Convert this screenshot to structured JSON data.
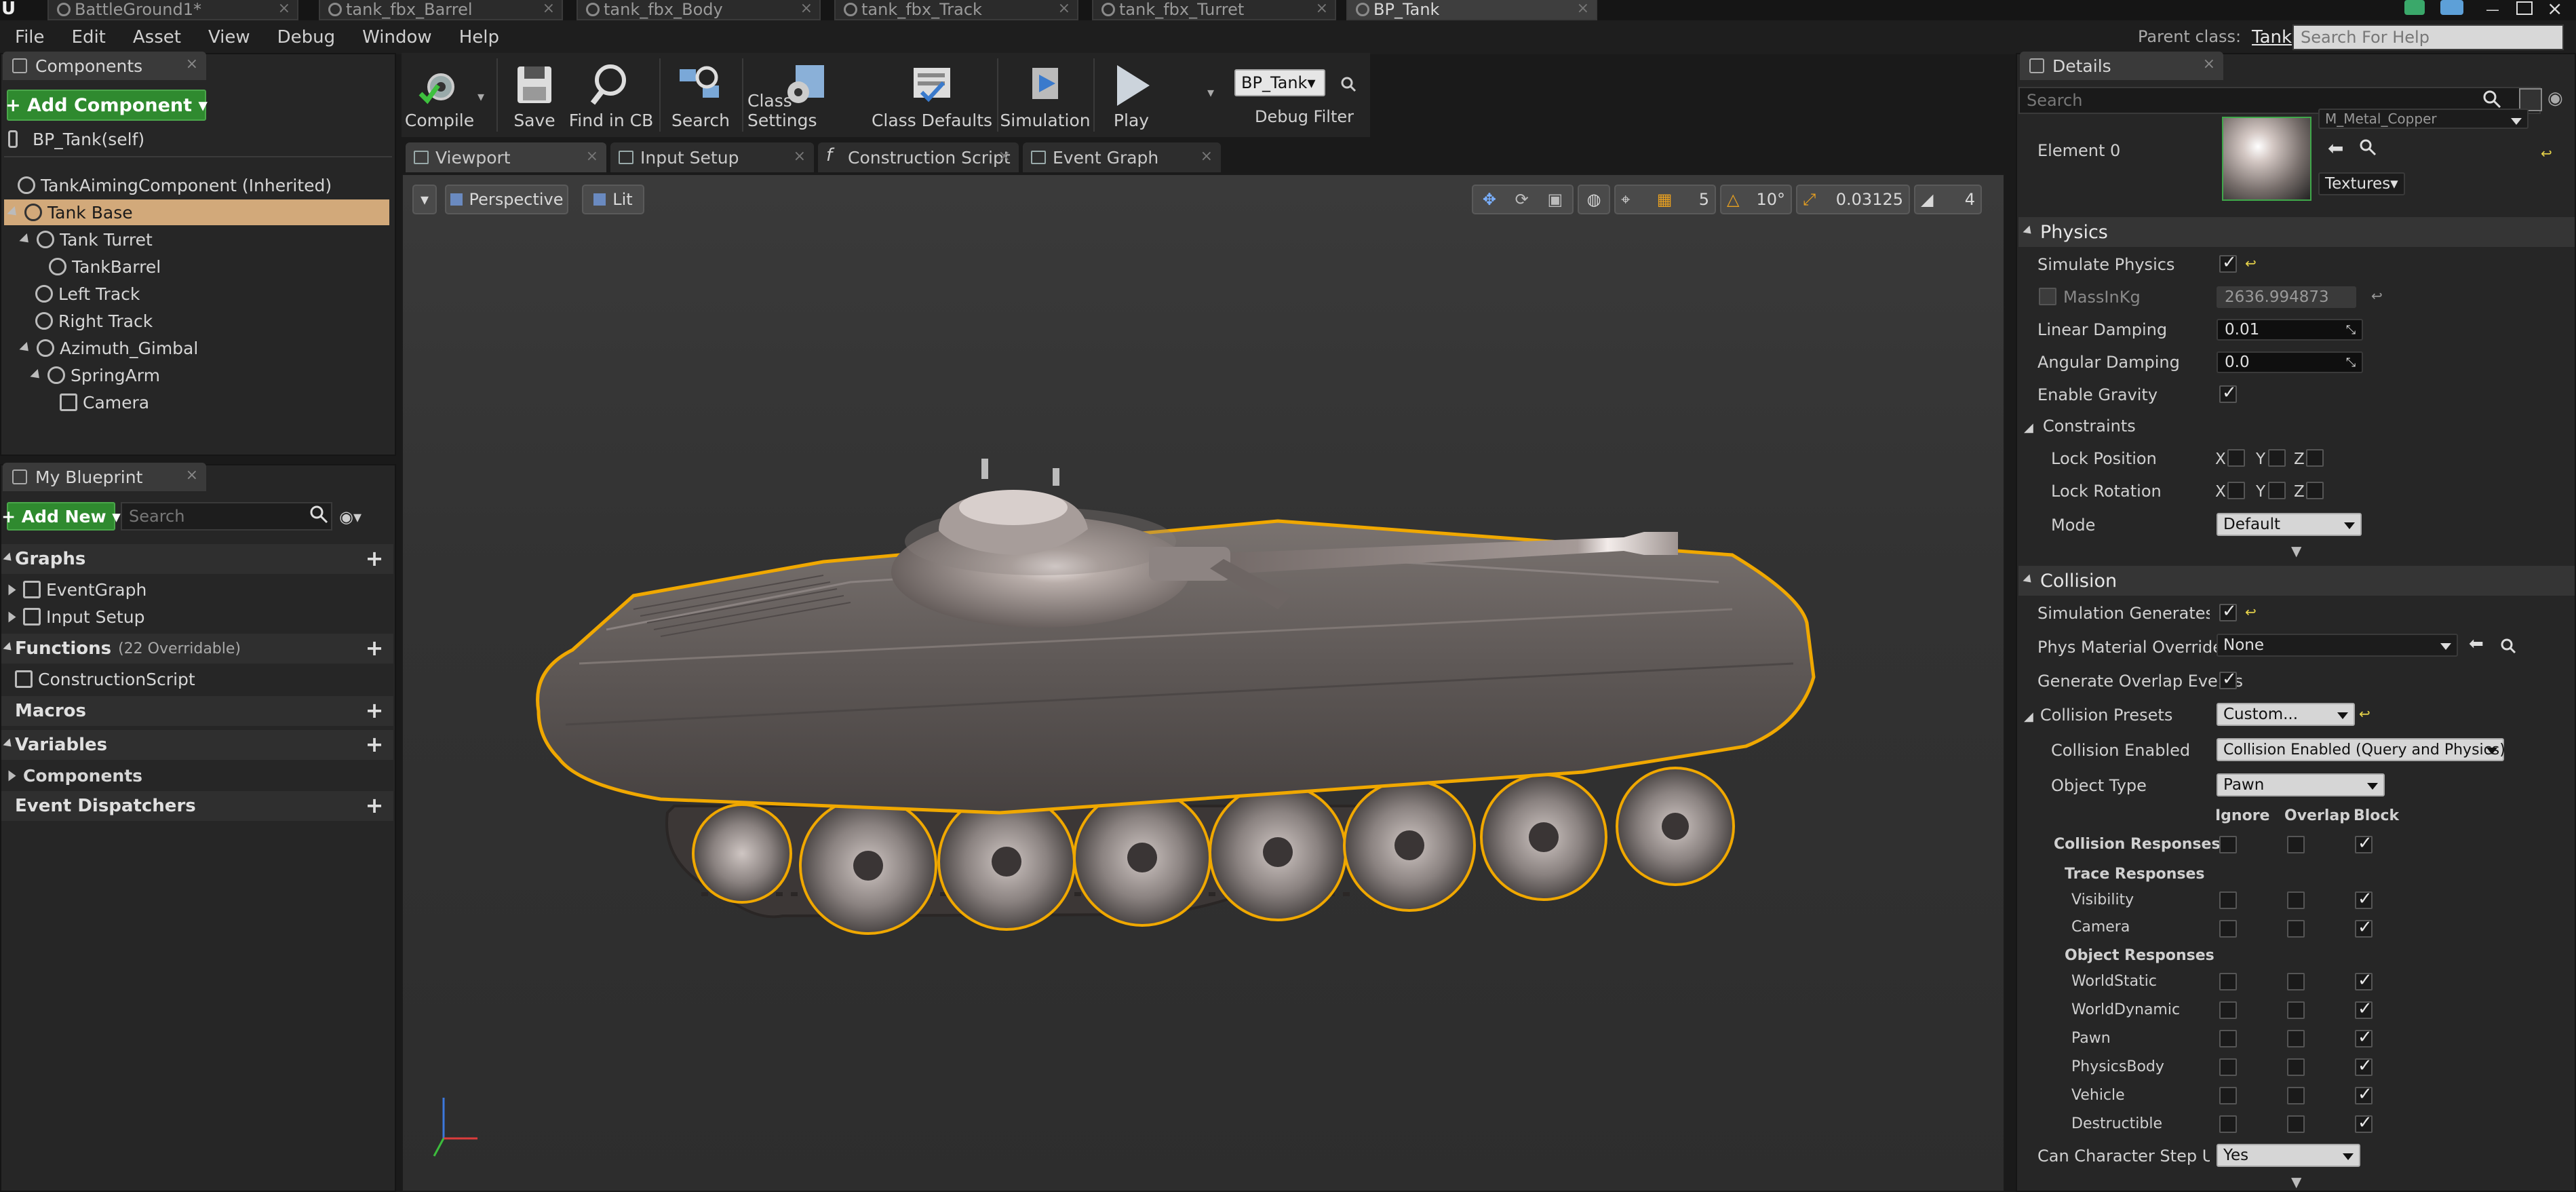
{
  "window": {
    "doc_tabs": [
      "BattleGround1*",
      "tank_fbx_Barrel",
      "tank_fbx_Body",
      "tank_fbx_Track",
      "tank_fbx_Turret",
      "BP_Tank"
    ]
  },
  "menu": [
    "File",
    "Edit",
    "Asset",
    "View",
    "Debug",
    "Window",
    "Help"
  ],
  "header_right": {
    "parent_class_label": "Parent class:",
    "parent_class_value": "Tank",
    "help_search_placeholder": "Search For Help"
  },
  "components": {
    "tab_label": "Components",
    "add_button": "+ Add Component ▾",
    "self_item": "BP_Tank(self)",
    "items": [
      {
        "label": "TankAimingComponent (Inherited)"
      },
      {
        "label": "Tank Base"
      },
      {
        "label": "Tank Turret"
      },
      {
        "label": "TankBarrel"
      },
      {
        "label": "Left Track"
      },
      {
        "label": "Right Track"
      },
      {
        "label": "Azimuth_Gimbal"
      },
      {
        "label": "SpringArm"
      },
      {
        "label": "Camera"
      }
    ]
  },
  "my_blueprint": {
    "tab_label": "My Blueprint",
    "add_new": "+ Add New ▾",
    "search_placeholder": "Search",
    "graphs_label": "Graphs",
    "graph_items": [
      "EventGraph",
      "Input Setup"
    ],
    "functions_label": "Functions",
    "functions_count": "(22 Overridable)",
    "function_items": [
      "ConstructionScript"
    ],
    "macros_label": "Macros",
    "variables_label": "Variables",
    "components_label": "Components",
    "dispatchers_label": "Event Dispatchers"
  },
  "toolbar": {
    "compile": "Compile",
    "save": "Save",
    "find_in_cb": "Find in CB",
    "search": "Search",
    "class_settings": "Class Settings",
    "class_defaults": "Class Defaults",
    "simulation": "Simulation",
    "play": "Play",
    "debug_object": "BP_Tank▾",
    "debug_filter": "Debug Filter"
  },
  "editor_tabs": [
    "Viewport",
    "Input Setup",
    "Construction Script",
    "Event Graph"
  ],
  "viewport": {
    "perspective": "Perspective",
    "lit": "Lit",
    "grid_snap": "5",
    "rot_snap": "10°",
    "scale_snap": "0.03125",
    "cam_speed": "4"
  },
  "details": {
    "tab_label": "Details",
    "search_placeholder": "Search",
    "material_name": "M_Metal_Copper",
    "element_label": "Element 0",
    "textures_btn": "Textures▾",
    "physics": {
      "header": "Physics",
      "simulate_physics": "Simulate Physics",
      "mass_label": "MassInKg",
      "mass_value": "2636.994873",
      "linear_damping": "Linear Damping",
      "linear_damping_value": "0.01",
      "angular_damping": "Angular Damping",
      "angular_damping_value": "0.0",
      "enable_gravity": "Enable Gravity",
      "constraints": "Constraints",
      "lock_position": "Lock Position",
      "lock_rotation": "Lock Rotation",
      "axis_x": "X",
      "axis_y": "Y",
      "axis_z": "Z",
      "mode": "Mode",
      "mode_value": "Default"
    },
    "collision": {
      "header": "Collision",
      "sim_generates_hit": "Simulation Generates Hit",
      "phys_material_override": "Phys Material Override",
      "phys_material_value": "None",
      "generate_overlap": "Generate Overlap Events",
      "presets": "Collision Presets",
      "presets_value": "Custom...",
      "collision_enabled": "Collision Enabled",
      "collision_enabled_value": "Collision Enabled (Query and Physics)",
      "object_type": "Object Type",
      "object_type_value": "Pawn",
      "col_ignore": "Ignore",
      "col_overlap": "Overlap",
      "col_block": "Block",
      "collision_responses": "Collision Responses",
      "trace_responses": "Trace Responses",
      "object_responses": "Object Responses",
      "trace_rows": [
        "Visibility",
        "Camera"
      ],
      "object_rows": [
        "WorldStatic",
        "WorldDynamic",
        "Pawn",
        "PhysicsBody",
        "Vehicle",
        "Destructible"
      ],
      "step_up": "Can Character Step Up On",
      "step_up_value": "Yes"
    }
  },
  "colors": {
    "accent_green": "#2f8a2f",
    "selection": "#d2a97a",
    "outline": "#f0a800"
  }
}
